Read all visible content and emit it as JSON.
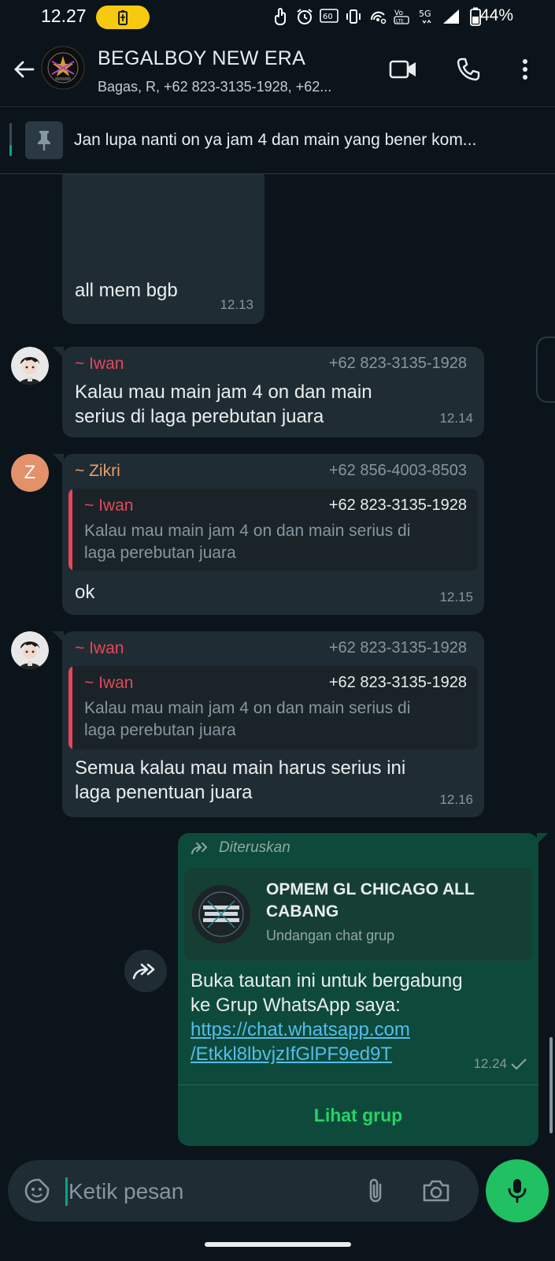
{
  "status_bar": {
    "time": "12.27",
    "battery_percent": "44%",
    "icons": [
      "tap-icon",
      "alarm-icon",
      "hd-icon",
      "vibrate-icon",
      "hotspot-icon",
      "volte-icon",
      "5g-icon",
      "signal-icon",
      "battery-icon"
    ],
    "labels": {
      "hd": "60",
      "volte": "VoLTE",
      "net": "5G"
    }
  },
  "header": {
    "title": "BEGALBOY NEW ERA",
    "members": "Bagas, R, +62 823-3135-1928, +62...",
    "avatar_icon": "group-logo-icon",
    "actions": [
      "video-call-icon",
      "voice-call-icon",
      "more-options-icon"
    ]
  },
  "pinned": {
    "text": "Jan lupa nanti on ya jam 4 dan main yang bener kom...",
    "icon": "pin-icon"
  },
  "messages": [
    {
      "type": "incoming-continued",
      "text": "all mem bgb",
      "time": "12.13"
    },
    {
      "type": "incoming",
      "sender": "~ Iwan",
      "sender_color": "#e5475a",
      "phone": "+62 823-3135-1928",
      "text_line1": "Kalau mau main jam 4 on dan main",
      "text_line2": "serius di laga perebutan juara",
      "time": "12.14"
    },
    {
      "type": "incoming-reply",
      "sender": "~ Zikri",
      "sender_color": "#e79f6d",
      "phone": "+62 856-4003-8503",
      "avatar_letter": "Z",
      "quote": {
        "sender": "~ Iwan",
        "phone": "+62 823-3135-1928",
        "text_line1": "Kalau mau main jam 4 on dan main serius di",
        "text_line2": "laga perebutan juara"
      },
      "text": "ok",
      "time": "12.15"
    },
    {
      "type": "incoming-reply",
      "sender": "~ Iwan",
      "sender_color": "#e5475a",
      "phone": "+62 823-3135-1928",
      "quote": {
        "sender": "~ Iwan",
        "phone": "+62 823-3135-1928",
        "text_line1": "Kalau mau main jam 4 on dan main serius di",
        "text_line2": "laga perebutan juara"
      },
      "text_line1": "Semua kalau mau main harus serius ini",
      "text_line2": "laga penentuan juara",
      "time": "12.16"
    },
    {
      "type": "outgoing-forwarded",
      "forward_label": "Diteruskan",
      "invite": {
        "title_line1": "OPMEM GL CHICAGO ALL",
        "title_line2": "CABANG",
        "subtitle": "Undangan chat grup"
      },
      "text_line1": "Buka tautan ini untuk bergabung",
      "text_line2": "ke Grup WhatsApp saya:",
      "link_line1": "https://chat.whatsapp.com",
      "link_line2": "/Etkkl8lbvjzIfGlPF9ed9T",
      "time": "12.24",
      "status": "sent-check-icon",
      "button": "Lihat grup"
    }
  ],
  "input": {
    "placeholder": "Ketik pesan",
    "icons": [
      "sticker-icon",
      "attach-icon",
      "camera-icon",
      "mic-icon"
    ]
  },
  "colors": {
    "bg": "#0b141a",
    "bubble_in": "#202c33",
    "bubble_out": "#0d4a3b",
    "accent": "#21c063",
    "link": "#53bdeb"
  }
}
